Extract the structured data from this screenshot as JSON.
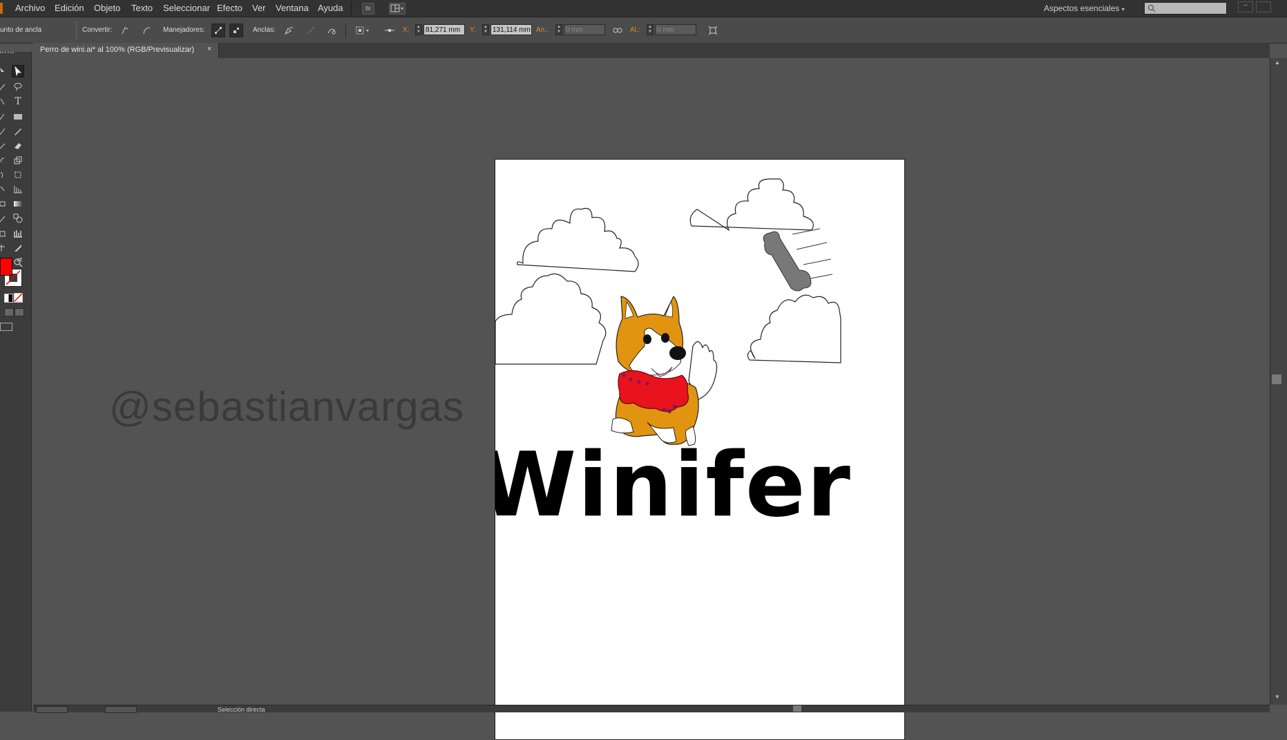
{
  "menu": [
    "Archivo",
    "Edición",
    "Objeto",
    "Texto",
    "Seleccionar",
    "Efecto",
    "Ver",
    "Ventana",
    "Ayuda"
  ],
  "bridge_label": "Br",
  "workspace": "Aspectos esenciales",
  "control": {
    "anchor_label": "unto de ancla",
    "convert_label": "Convertir:",
    "handles_label": "Manejadores:",
    "anchors_label": "Anclas:",
    "x_label": "X:",
    "x_value": "81,271 mm",
    "y_label": "Y:",
    "y_value": "131,114 mm",
    "w_label": "An.:",
    "w_value": "0 mm",
    "h_label": "Al.:",
    "h_value": "0 mm"
  },
  "tab": {
    "title": "Perro de wini.ai* al 100% (RGB/Previsualizar)",
    "close": "×"
  },
  "artwork": {
    "title": "Winifer"
  },
  "watermark": "@sebastianvargas",
  "status": {
    "tool": "Selección directa"
  },
  "colors": {
    "fill": "#ff0000",
    "stroke": "#000000",
    "dog_fur": "#e0940f",
    "collar": "#e8131c",
    "bone": "#787878"
  }
}
